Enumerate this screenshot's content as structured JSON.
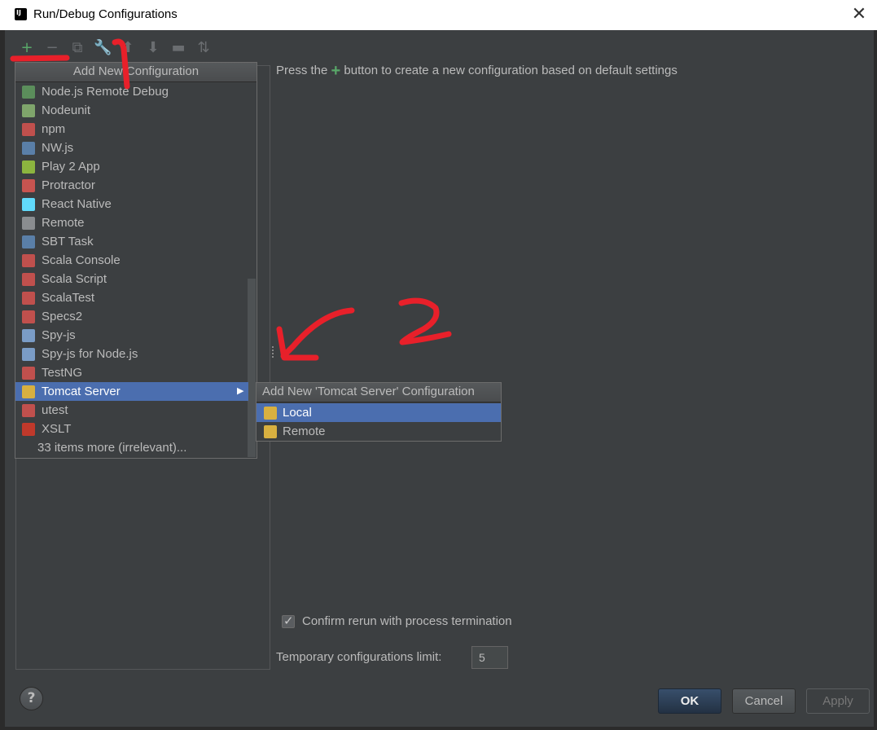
{
  "window": {
    "title": "Run/Debug Configurations"
  },
  "toolbar": {
    "buttons": [
      {
        "name": "add",
        "glyph": "+",
        "color": "#59a869"
      },
      {
        "name": "remove",
        "glyph": "−",
        "color": "#6a6d70"
      },
      {
        "name": "copy",
        "glyph": "⧉",
        "color": "#6a6d70"
      },
      {
        "name": "edit-defaults",
        "glyph": "🔧",
        "color": "#6a6d70"
      },
      {
        "name": "move-up",
        "glyph": "⬆",
        "color": "#6a6d70"
      },
      {
        "name": "move-down",
        "glyph": "⬇",
        "color": "#6a6d70"
      },
      {
        "name": "folder",
        "glyph": "▬",
        "color": "#6a6d70"
      },
      {
        "name": "sort",
        "glyph": "⇅",
        "color": "#6a6d70"
      }
    ]
  },
  "popup": {
    "title": "Add New Configuration",
    "items": [
      {
        "label": "Node.js Remote Debug",
        "icon": "nodejs-debug-icon",
        "color": "#5b8e5b"
      },
      {
        "label": "Nodeunit",
        "icon": "nodeunit-icon",
        "color": "#7fa56b"
      },
      {
        "label": "npm",
        "icon": "npm-icon",
        "color": "#c0504d"
      },
      {
        "label": "NW.js",
        "icon": "nwjs-icon",
        "color": "#5a7fa8"
      },
      {
        "label": "Play 2 App",
        "icon": "play-icon",
        "color": "#8cb43f"
      },
      {
        "label": "Protractor",
        "icon": "protractor-icon",
        "color": "#c75450"
      },
      {
        "label": "React Native",
        "icon": "react-icon",
        "color": "#61dafb"
      },
      {
        "label": "Remote",
        "icon": "remote-icon",
        "color": "#8a8d90"
      },
      {
        "label": "SBT Task",
        "icon": "sbt-icon",
        "color": "#5a7fa8"
      },
      {
        "label": "Scala Console",
        "icon": "scala-console-icon",
        "color": "#c0504d"
      },
      {
        "label": "Scala Script",
        "icon": "scala-script-icon",
        "color": "#c0504d"
      },
      {
        "label": "ScalaTest",
        "icon": "scalatest-icon",
        "color": "#c0504d"
      },
      {
        "label": "Specs2",
        "icon": "specs2-icon",
        "color": "#c0504d"
      },
      {
        "label": "Spy-js",
        "icon": "spyjs-icon",
        "color": "#7a9cc6"
      },
      {
        "label": "Spy-js for Node.js",
        "icon": "spyjs-node-icon",
        "color": "#7a9cc6"
      },
      {
        "label": "TestNG",
        "icon": "testng-icon",
        "color": "#c0504d"
      },
      {
        "label": "Tomcat Server",
        "icon": "tomcat-icon",
        "color": "#d8b040",
        "selected": true,
        "submenu": true
      },
      {
        "label": "utest",
        "icon": "utest-icon",
        "color": "#c0504d"
      },
      {
        "label": "XSLT",
        "icon": "xslt-icon",
        "color": "#c0392b"
      },
      {
        "label": "33 items more (irrelevant)...",
        "icon": "",
        "color": ""
      }
    ]
  },
  "submenu": {
    "title": "Add New 'Tomcat Server' Configuration",
    "items": [
      {
        "label": "Local",
        "selected": true
      },
      {
        "label": "Remote",
        "selected": false
      }
    ]
  },
  "hint": {
    "before": "Press the",
    "after": "button to create a new configuration based on default settings"
  },
  "options": {
    "confirm_rerun": {
      "label": "Confirm rerun with process termination",
      "checked": true
    },
    "temp_limit": {
      "label": "Temporary configurations limit:",
      "value": "5"
    }
  },
  "buttons": {
    "help": "?",
    "ok": "OK",
    "cancel": "Cancel",
    "apply": "Apply"
  },
  "annotations": {
    "color": "#e8202a",
    "labels": [
      "1",
      "2"
    ]
  }
}
